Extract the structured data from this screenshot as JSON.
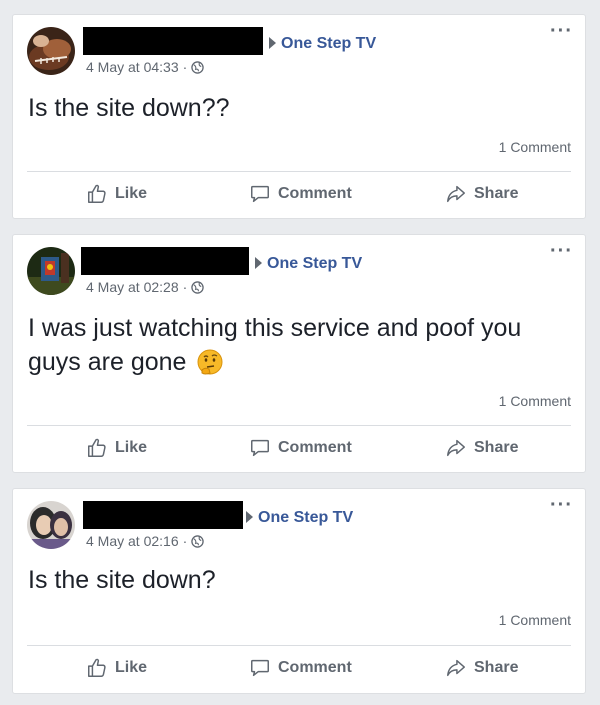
{
  "posts": [
    {
      "page_name": "One Step TV",
      "timestamp": "4 May at 04:33",
      "separator": "·",
      "text": "Is the site down??",
      "comment_count": "1 Comment",
      "actions": {
        "like": "Like",
        "comment": "Comment",
        "share": "Share"
      }
    },
    {
      "page_name": "One Step TV",
      "timestamp": "4 May at 02:28",
      "separator": "·",
      "text": "I was just watching this service and poof you guys are gone",
      "comment_count": "1 Comment",
      "actions": {
        "like": "Like",
        "comment": "Comment",
        "share": "Share"
      }
    },
    {
      "page_name": "One Step TV",
      "timestamp": "4 May at 02:16",
      "separator": "·",
      "text": "Is the site down?",
      "comment_count": "1 Comment",
      "actions": {
        "like": "Like",
        "comment": "Comment",
        "share": "Share"
      }
    }
  ],
  "icons": {
    "more": "more-options-icon",
    "privacy": "globe-icon",
    "like": "thumbs-up-icon",
    "comment": "speech-bubble-icon",
    "share": "share-arrow-icon",
    "emoji": "thinking-face-emoji"
  },
  "colors": {
    "page_link": "#385898",
    "secondary_text": "#606770",
    "background": "#e9ebee",
    "card": "#ffffff"
  }
}
